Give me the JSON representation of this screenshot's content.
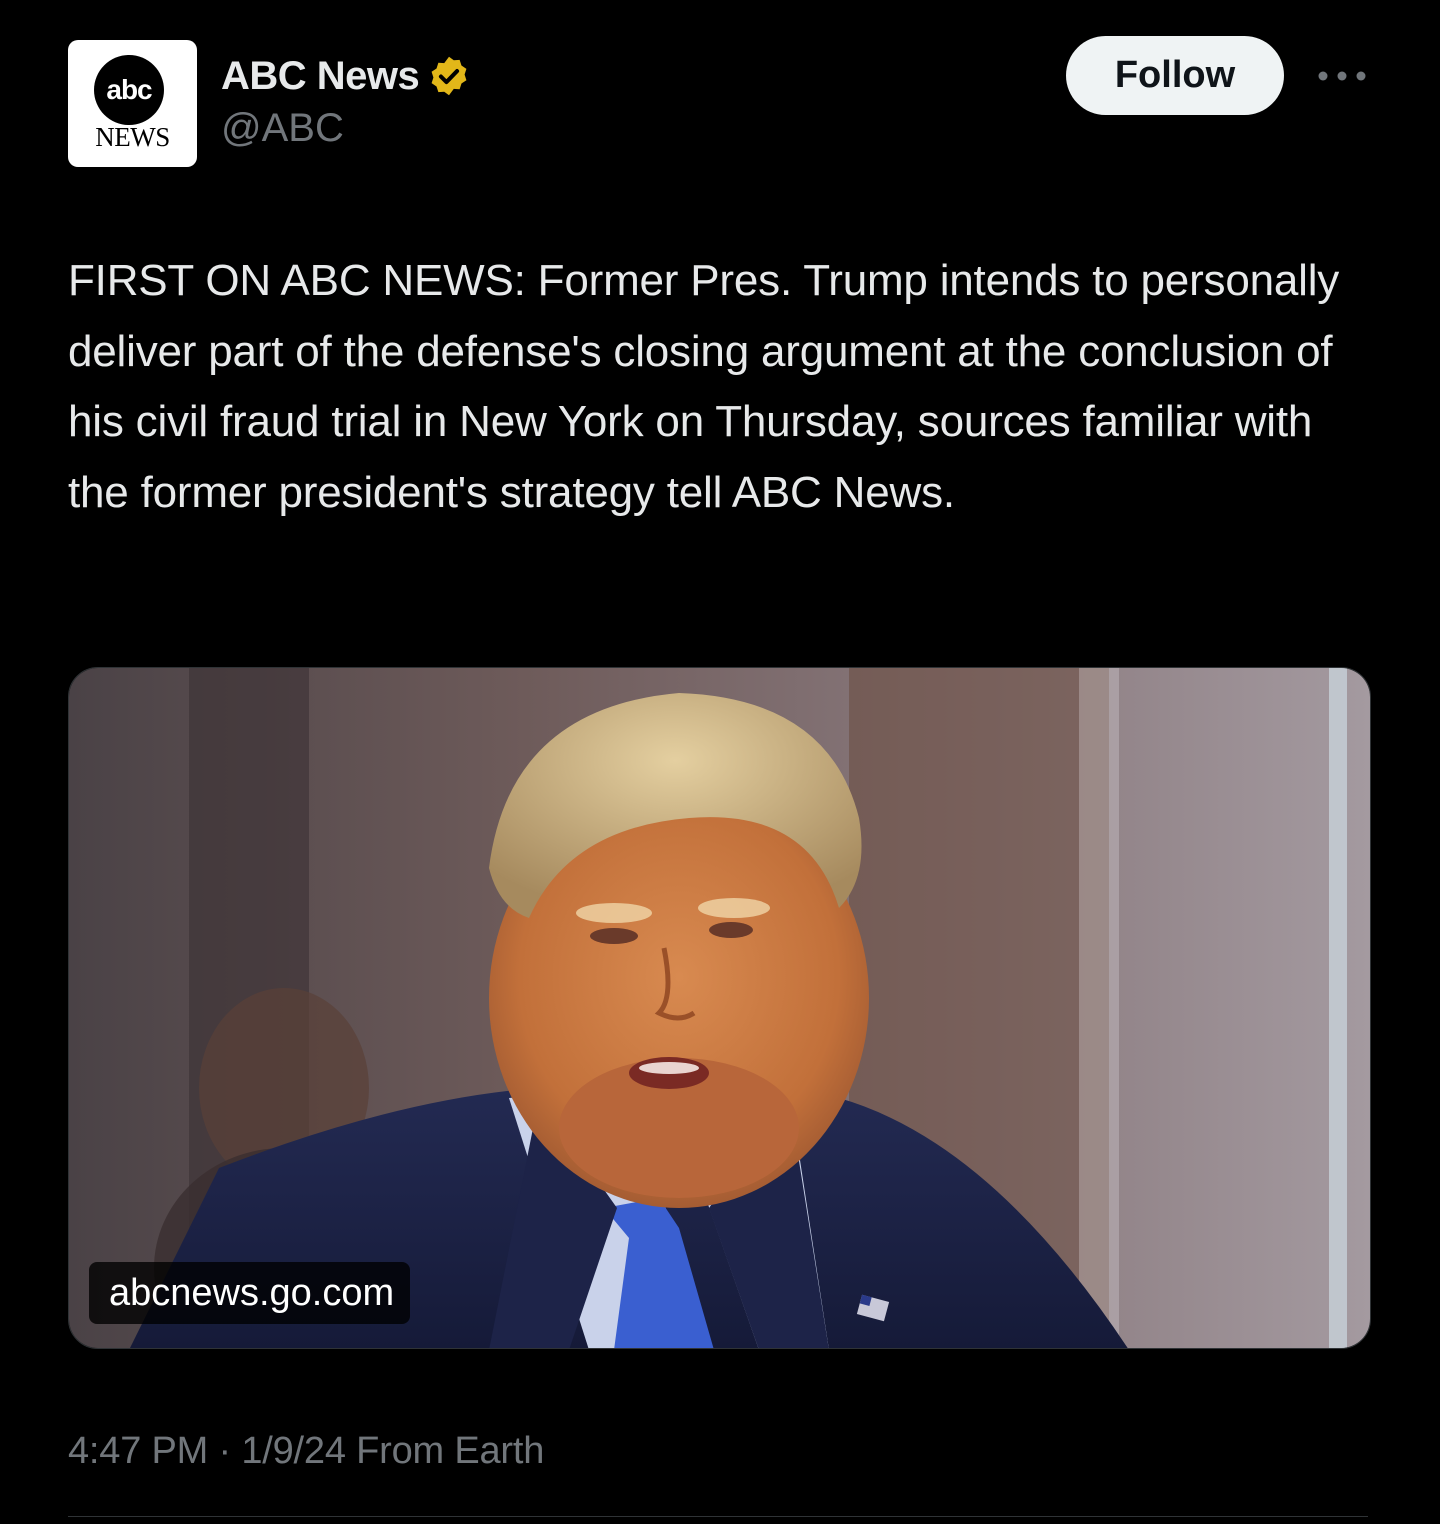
{
  "account": {
    "display_name": "ABC News",
    "handle": "@ABC",
    "verified": true,
    "verified_color": "#e2b719",
    "avatar": {
      "logo_text": "abc",
      "logo_subtext": "NEWS"
    }
  },
  "actions": {
    "follow_label": "Follow",
    "more_icon": "more-horizontal-icon"
  },
  "tweet": {
    "text": "FIRST ON ABC NEWS: Former Pres. Trump intends to personally deliver part of the defense's closing argument at the conclusion of his civil fraud trial in New York on Thursday, sources familiar with the former president's strategy tell ABC News."
  },
  "link_card": {
    "domain": "abcnews.go.com"
  },
  "meta": {
    "time": "4:47 PM",
    "separator": "·",
    "date": "1/9/24",
    "source": "From Earth"
  },
  "colors": {
    "background": "#000000",
    "text_primary": "#e7e9ea",
    "text_secondary": "#71767b",
    "follow_bg": "#eff3f4"
  }
}
